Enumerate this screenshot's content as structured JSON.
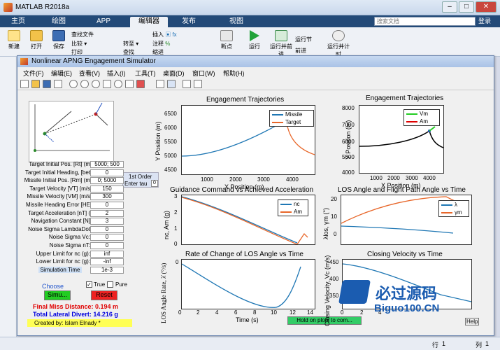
{
  "matlab": {
    "title": "MATLAB R2018a",
    "tabs": [
      "主页",
      "绘图",
      "APP",
      "编辑器",
      "发布",
      "视图"
    ],
    "active_tab": "编辑器",
    "search_placeholder": "搜索文档",
    "login": "登录",
    "ribbon": {
      "new": "新建",
      "open": "打开",
      "save": "保存",
      "find_files": "查找文件",
      "compare": "比较",
      "print": "打印",
      "goto": "转至",
      "find": "查找",
      "insert": "插入",
      "comment": "注释",
      "indent": "缩进",
      "breakpoints": "断点",
      "run": "运行",
      "run_advance": "运行并前进",
      "run_section": "运行节",
      "advance": "前进",
      "run_time": "运行并计时"
    },
    "status": {
      "row_label": "行",
      "row_value": "1",
      "col_label": "列",
      "col_value": "1"
    }
  },
  "figure": {
    "title": "Nonlinear APNG Engagement Simulator",
    "menu": [
      "文件(F)",
      "编辑(E)",
      "查看(V)",
      "插入(I)",
      "工具(T)",
      "桌面(D)",
      "窗口(W)",
      "帮助(H)"
    ]
  },
  "panel": {
    "params": [
      {
        "label": "Target Initial Pos. [Rt] (m",
        "value": "5000; 500"
      },
      {
        "label": "Target Initial Heading, [bet",
        "value": "0"
      },
      {
        "label": "Missile Initial Pos. [Rm] (m",
        "value": "0; 5000"
      },
      {
        "label": "Target Velocity [VT] (m/s",
        "value": "150"
      },
      {
        "label": "Missile Velocity [VM] (m/s",
        "value": "300"
      },
      {
        "label": "Missile Heading Error [HE",
        "value": "0"
      },
      {
        "label": "Target Acceleration [nT] (",
        "value": "2"
      },
      {
        "label": "Navigation Constant [N]",
        "value": "3"
      },
      {
        "label": "Noise Sigma LambdaDot",
        "value": "0"
      },
      {
        "label": "Noise Sigma Vc:",
        "value": "0"
      },
      {
        "label": "Noise Sigma nT:",
        "value": "0"
      },
      {
        "label": "Upper Limit for nc (g):",
        "value": "inf"
      },
      {
        "label": "Lower Limit for nc (g):",
        "value": "-inf"
      },
      {
        "label": "Simulation Time",
        "value": "1e-3"
      }
    ],
    "first_order_label": "1st Order",
    "enter_tau_label": "Enter tau",
    "tau_value": "0",
    "choose_label": "Choose",
    "true_label": "True",
    "pure_label": "Pure",
    "simulate_button": "Simu...",
    "reset_button": "Reset",
    "final_miss": "Final Miss Distance:  0.194 m",
    "total_lateral": "Total Lateral Divert:  14.216 g",
    "created_by": "Created by: Islam Elnady *",
    "hold_on": "Hold on plots to com...",
    "colors": {
      "red": "#e00000",
      "blue": "#0000dd",
      "green_btn": "#22cc22",
      "red_btn": "#ee2222",
      "yellow": "#ffff55"
    }
  },
  "plots": [
    {
      "title": "Engagement Trajectories",
      "xlabel": "X Position (m)",
      "ylabel": "Y Position (m)",
      "xticks": [
        "1000",
        "2000",
        "3000",
        "4000"
      ],
      "yticks": [
        "6500",
        "6000",
        "5500",
        "5000",
        "4500"
      ],
      "legend": [
        "Missile",
        "Target"
      ]
    },
    {
      "title": "Engagement Trajectories",
      "xlabel": "X Position (m)",
      "ylabel": "Y Position (m)",
      "xticks": [
        "1000",
        "2000",
        "3000",
        "4000"
      ],
      "yticks": [
        "8000",
        "7000",
        "6000",
        "5000",
        "4000"
      ],
      "legend": [
        "Vm",
        "Am"
      ]
    },
    {
      "title": "Guidance Command vs Achieved Acceleration",
      "xlabel": "",
      "ylabel": "nc, Am (g)",
      "xticks": [
        "0",
        "2",
        "4",
        "6",
        "8",
        "10",
        "12",
        "14"
      ],
      "yticks": [
        "3",
        "2",
        "1",
        "0"
      ],
      "legend": [
        "nc",
        "Am"
      ]
    },
    {
      "title": "LOS Angle and Flight Path Angle vs Time",
      "xlabel": "",
      "ylabel": "λlos, γm (°)",
      "xticks": [
        "0",
        "2",
        "4",
        "6",
        "8",
        "10",
        "12",
        "14"
      ],
      "yticks": [
        "20",
        "10",
        "0"
      ],
      "legend": [
        "λ",
        "γm"
      ]
    },
    {
      "title": "Rate of Change of LOS Angle vs Time",
      "xlabel": "Time (s)",
      "ylabel": "LOS Angle Rate, λ̇ (°/s)",
      "xticks": [
        "0",
        "2",
        "4",
        "6",
        "8",
        "10",
        "12",
        "14"
      ],
      "yticks": [
        "0"
      ]
    },
    {
      "title": "Closing Velocity vs Time",
      "xlabel": "",
      "ylabel": "Closing Velocity, Vc (m/s)",
      "xticks": [
        "0",
        "2",
        "4"
      ],
      "yticks": [
        "450",
        "400",
        "350"
      ]
    }
  ],
  "watermark": {
    "text": "必过源码",
    "sub": "Biguo100.CN"
  }
}
